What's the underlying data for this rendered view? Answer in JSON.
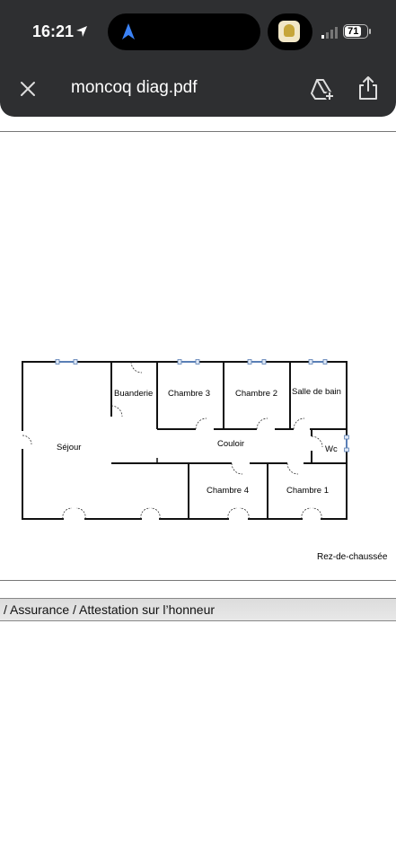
{
  "status_bar": {
    "time": "16:21",
    "battery": "71"
  },
  "header": {
    "title": "moncoq diag.pdf",
    "icons": [
      "close-icon",
      "add-to-drive-icon",
      "share-icon"
    ]
  },
  "floor_plan": {
    "rooms": {
      "buanderie": "Buanderie",
      "chambre3": "Chambre 3",
      "chambre2": "Chambre 2",
      "salle_de_bain": "Salle de bain",
      "sejour": "Séjour",
      "couloir": "Couloir",
      "wc": "Wc",
      "chambre4": "Chambre 4",
      "chambre1": "Chambre 1"
    },
    "caption": "Rez-de-chaussée"
  },
  "next_section": {
    "breadcrumb": "/ Assurance / Attestation sur l’honneur"
  }
}
